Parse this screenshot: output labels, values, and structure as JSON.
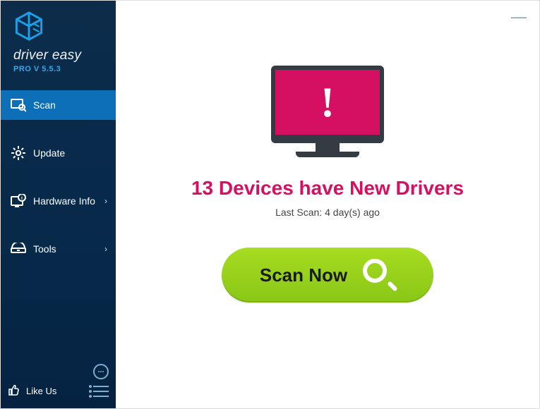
{
  "brand": {
    "name": "driver easy",
    "edition": "PRO V 5.5.3"
  },
  "sidebar": {
    "items": [
      {
        "label": "Scan",
        "active": true
      },
      {
        "label": "Update",
        "active": false
      },
      {
        "label": "Hardware Info",
        "active": false,
        "chevron": true
      },
      {
        "label": "Tools",
        "active": false,
        "chevron": true
      }
    ],
    "like_label": "Like Us"
  },
  "main": {
    "headline": "13 Devices have New Drivers",
    "device_count": 13,
    "last_scan_label": "Last Scan: 4 day(s) ago",
    "scan_button_label": "Scan Now"
  },
  "colors": {
    "accent_pink": "#d51062",
    "accent_green": "#94cf1c",
    "sidebar_blue": "#0c2c4a",
    "active_blue": "#0d6fb8",
    "logo_blue": "#1aa0e8"
  }
}
